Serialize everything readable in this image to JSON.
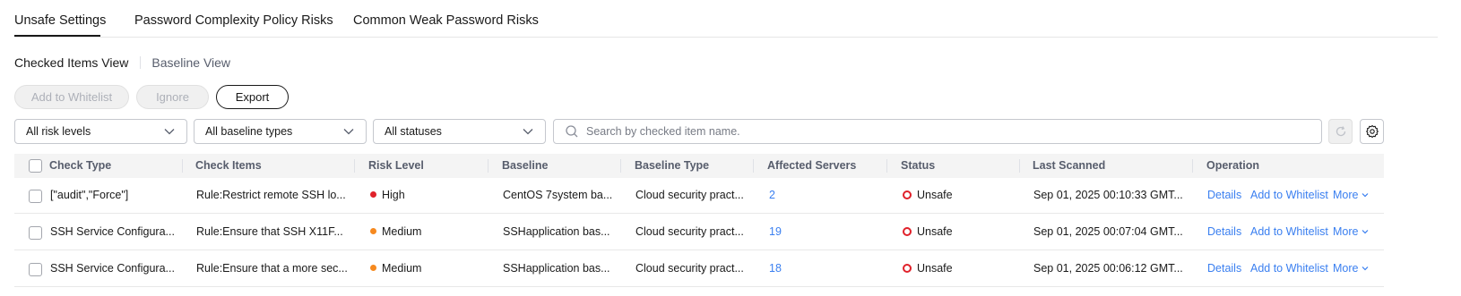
{
  "tabs": [
    {
      "label": "Unsafe Settings",
      "active": true
    },
    {
      "label": "Password Complexity Policy Risks",
      "active": false
    },
    {
      "label": "Common Weak Password Risks",
      "active": false
    }
  ],
  "views": {
    "checked": "Checked Items View",
    "baseline": "Baseline View"
  },
  "toolbar": {
    "whitelist": "Add to Whitelist",
    "ignore": "Ignore",
    "export": "Export"
  },
  "filters": {
    "risk": "All risk levels",
    "baseline_type": "All baseline types",
    "status": "All statuses",
    "search_placeholder": "Search by checked item name."
  },
  "table": {
    "headers": [
      "Check Type",
      "Check Items",
      "Risk Level",
      "Baseline",
      "Baseline Type",
      "Affected Servers",
      "Status",
      "Last Scanned",
      "Operation"
    ],
    "rows": [
      {
        "check_type": "[\"audit\",\"Force\"]",
        "check_item": "Rule:Restrict remote SSH lo...",
        "risk": "High",
        "baseline": "CentOS 7system ba...",
        "baseline_type": "Cloud security pract...",
        "servers": "2",
        "status": "Unsafe",
        "scanned": "Sep 01, 2025 00:10:33 GMT...",
        "op_details": "Details",
        "op_whitelist": "Add to Whitelist",
        "op_more": "More"
      },
      {
        "check_type": "SSH Service Configura...",
        "check_item": "Rule:Ensure that SSH X11F...",
        "risk": "Medium",
        "baseline": "SSHapplication bas...",
        "baseline_type": "Cloud security pract...",
        "servers": "19",
        "status": "Unsafe",
        "scanned": "Sep 01, 2025 00:07:04 GMT...",
        "op_details": "Details",
        "op_whitelist": "Add to Whitelist",
        "op_more": "More"
      },
      {
        "check_type": "SSH Service Configura...",
        "check_item": "Rule:Ensure that a more sec...",
        "risk": "Medium",
        "baseline": "SSHapplication bas...",
        "baseline_type": "Cloud security pract...",
        "servers": "18",
        "status": "Unsafe",
        "scanned": "Sep 01, 2025 00:06:12 GMT...",
        "op_details": "Details",
        "op_whitelist": "Add to Whitelist",
        "op_more": "More"
      }
    ]
  },
  "colors": {
    "high": "#e0212a",
    "medium": "#f6891f",
    "link": "#3a7ff0"
  },
  "icons": [
    "chevron-down-icon",
    "search-icon",
    "refresh-icon",
    "gear-icon",
    "unsafe-status-icon"
  ]
}
